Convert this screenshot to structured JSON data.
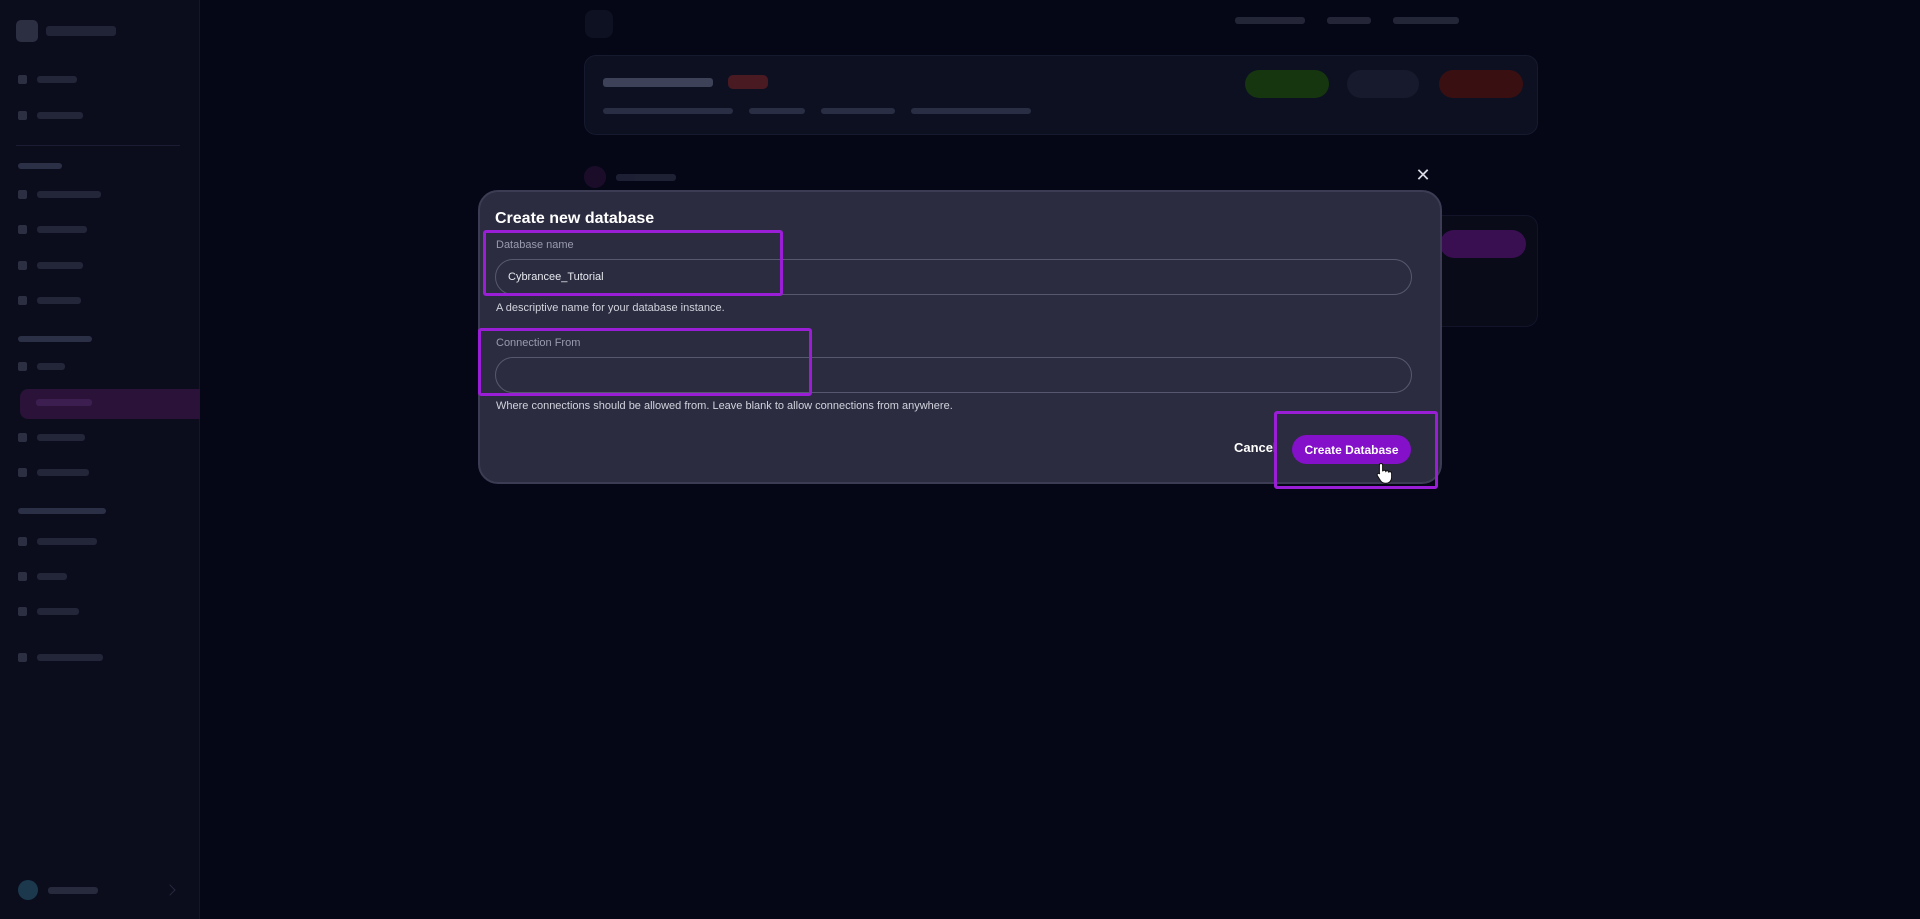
{
  "modal": {
    "title": "Create new database",
    "close_icon": "close-icon",
    "database_name": {
      "label": "Database name",
      "value": "Cybrancee_Tutorial",
      "helper": "A descriptive name for your database instance."
    },
    "connection_from": {
      "label": "Connection From",
      "value": "",
      "helper": "Where connections should be allowed from. Leave blank to allow connections from anywhere."
    },
    "cancel_label": "Cancel",
    "create_label": "Create Database"
  },
  "colors": {
    "accent": "#8410c9",
    "highlight": "#9a1ed6",
    "modal_bg": "#2b2c3f",
    "page_bg": "#050716"
  },
  "cursor_icon": "hand-pointer-icon"
}
